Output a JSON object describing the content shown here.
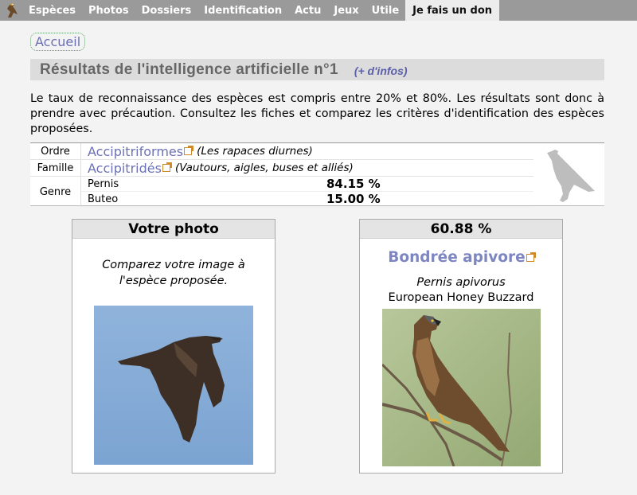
{
  "nav": {
    "items": [
      {
        "label": "Espèces"
      },
      {
        "label": "Photos"
      },
      {
        "label": "Dossiers"
      },
      {
        "label": "Identification"
      },
      {
        "label": "Actu"
      },
      {
        "label": "Jeux"
      },
      {
        "label": "Utile"
      },
      {
        "label": "Je fais un don",
        "active": true
      }
    ]
  },
  "breadcrumb": "Accueil",
  "title": "Résultats de l'intelligence artificielle n°1",
  "more_info": "(+ d'infos)",
  "intro": "Le taux de reconnaissance des espèces est compris entre 20% et 80%. Les résultats sont donc à prendre avec précaution. Consultez les fiches et comparez les critères d'identification des espèces proposées.",
  "taxonomy": {
    "order": {
      "label": "Ordre",
      "name": "Accipitriformes",
      "note": "(Les rapaces diurnes)"
    },
    "family": {
      "label": "Famille",
      "name": "Accipitridés",
      "note": "(Vautours, aigles, buses et alliés)"
    },
    "genus": {
      "label": "Genre",
      "items": [
        {
          "name": "Pernis",
          "pct": "84.15 %"
        },
        {
          "name": "Buteo",
          "pct": "15.00 %"
        }
      ]
    }
  },
  "your_photo": {
    "heading": "Votre photo",
    "text": "Comparez votre image à l'espèce proposée."
  },
  "result": {
    "score": "60.88 %",
    "species": "Bondrée apivore",
    "scientific": "Pernis apivorus",
    "common_en": "European Honey Buzzard"
  },
  "colors": {
    "nav_bg": "#9a9a9a",
    "link": "#6c70b5",
    "title_bar": "#dcdcdc"
  }
}
